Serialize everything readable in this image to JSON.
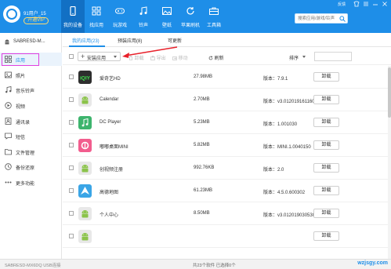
{
  "header": {
    "user": "91用户_15",
    "vip_label": "开通VIP",
    "feedback": "反馈",
    "search_placeholder": "搜索应用/游戏/铃声",
    "nav": [
      {
        "label": "我的设备",
        "icon": "phone-icon",
        "active": true
      },
      {
        "label": "找应用",
        "icon": "apps-icon",
        "active": false
      },
      {
        "label": "玩游戏",
        "icon": "gamepad-icon",
        "active": false
      },
      {
        "label": "铃声",
        "icon": "music-icon",
        "active": false
      },
      {
        "label": "壁纸",
        "icon": "wallpaper-icon",
        "active": false
      },
      {
        "label": "苹果刷机",
        "icon": "refresh-icon",
        "active": false
      },
      {
        "label": "工具箱",
        "icon": "toolbox-icon",
        "active": false
      }
    ]
  },
  "sidebar": {
    "device_name": "SABRESD-M...",
    "items": [
      {
        "label": "应用",
        "icon": "grid-icon",
        "active": true
      },
      {
        "label": "照片",
        "icon": "photo-icon",
        "active": false
      },
      {
        "label": "音乐铃声",
        "icon": "music-note-icon",
        "active": false
      },
      {
        "label": "视频",
        "icon": "video-icon",
        "active": false
      },
      {
        "label": "通讯录",
        "icon": "contacts-icon",
        "active": false
      },
      {
        "label": "短信",
        "icon": "sms-icon",
        "active": false
      },
      {
        "label": "文件管理",
        "icon": "folder-icon",
        "active": false
      },
      {
        "label": "备份还原",
        "icon": "backup-icon",
        "active": false
      },
      {
        "label": "更多功能",
        "icon": "more-icon",
        "active": false
      }
    ]
  },
  "tabs": [
    {
      "label": "我的应用(23)",
      "active": true
    },
    {
      "label": "预装应用(8)",
      "active": false
    },
    {
      "label": "可更新",
      "active": false
    }
  ],
  "toolbar": {
    "install": "安装应用",
    "uninstall": "卸载",
    "export": "导出",
    "move": "移动",
    "refresh": "刷新",
    "sort": "排序"
  },
  "apps": [
    {
      "name": "爱奇艺HD",
      "size": "27.98MB",
      "version": "版本：7.9.1",
      "icon": "iqiyi-icon",
      "color": "#2e2e2e",
      "button": "卸载"
    },
    {
      "name": "Calendar",
      "size": "2.70MB",
      "version": "版本：v3.0120191611601",
      "icon": "android-icon",
      "color": "#e8e8e8",
      "button": "卸载"
    },
    {
      "name": "DC Player",
      "size": "5.23MB",
      "version": "版本：1.001030",
      "icon": "music-player-icon",
      "color": "#3db46d",
      "button": "卸载"
    },
    {
      "name": "嘟嘟桌面MINI",
      "size": "5.82MB",
      "version": "版本：MINI.1.0040150",
      "icon": "dudu-icon",
      "color": "#f25d8e",
      "button": "卸载"
    },
    {
      "name": "创视频注册",
      "size": "992.76KB",
      "version": "版本：2.0",
      "icon": "android-icon",
      "color": "#e8e8e8",
      "button": "卸载"
    },
    {
      "name": "高德地图",
      "size": "61.23MB",
      "version": "版本：4.5.0.600302",
      "icon": "amap-icon",
      "color": "#3aa5e6",
      "button": "卸载"
    },
    {
      "name": "个人中心",
      "size": "8.50MB",
      "version": "版本：v3.0120190305301",
      "icon": "android-icon",
      "color": "#e8e8e8",
      "button": "卸载"
    },
    {
      "name": "",
      "size": "",
      "version": "",
      "icon": "android-icon",
      "color": "#e8e8e8",
      "button": "卸载"
    }
  ],
  "status": {
    "device": "SABRESD-MX6DQ  USB连接",
    "summary": "共23个软件   已选择0个",
    "watermark": "wzjsgy.com"
  },
  "colors": {
    "accent": "#1e8ee8",
    "annotation": "#e040e0",
    "arrow": "#e8212b"
  }
}
